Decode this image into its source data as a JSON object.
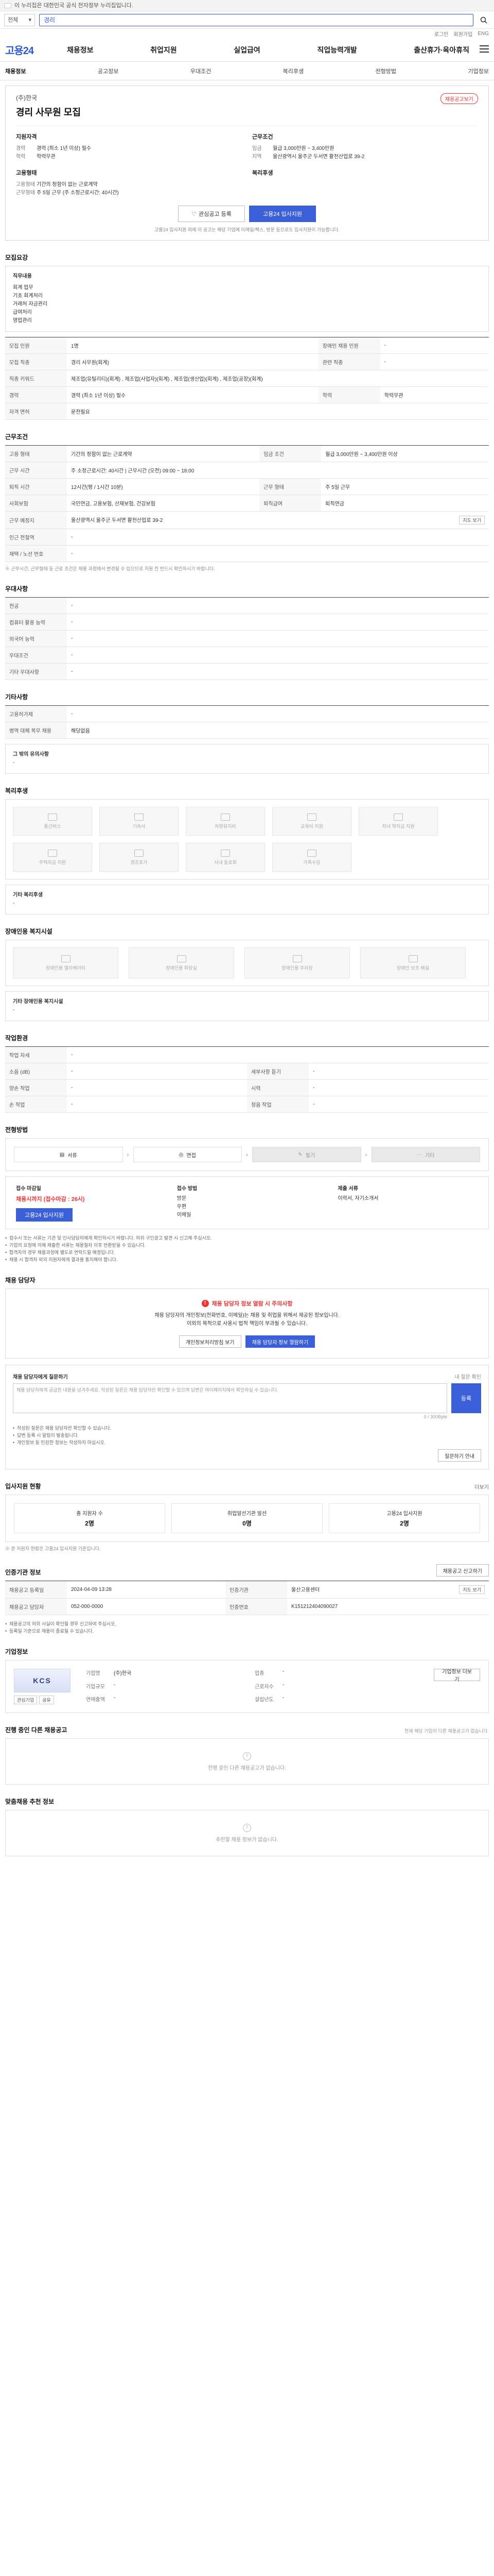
{
  "gov_bar": {
    "text": "이 누리집은 대한민국 공식 전자정부 누리집입니다."
  },
  "search": {
    "scope": "전체",
    "query": "경리"
  },
  "util_links": [
    "로그인",
    "회원가입",
    "ENG"
  ],
  "header": {
    "logo": "고용24",
    "menu": [
      "채용정보",
      "취업지원",
      "실업급여",
      "직업능력개발",
      "출산휴가·육아휴직"
    ]
  },
  "lnb": {
    "items": [
      "채용정보",
      "공고정보",
      "우대조건",
      "복리후생",
      "전형방법",
      "기업정보"
    ],
    "active": 0
  },
  "summary": {
    "company": "(주)한국",
    "title": "경리 사무원 모집",
    "badge": "채용공고보기",
    "cols": [
      {
        "heading": "지원자격",
        "rows": [
          {
            "k": "경력",
            "v": "경력 (최소 1년 이상) 필수"
          },
          {
            "k": "학력",
            "v": "학력무관"
          },
          {
            "k": "",
            "v": ""
          }
        ],
        "heading2": "고용형태",
        "rows2": [
          {
            "k": "고용형태",
            "v": "기간의 정함이 없는 근로계약"
          },
          {
            "k": "근무형태",
            "v": "주 5일 근무 (주 소정근로시간: 40시간)"
          }
        ]
      },
      {
        "heading": "근무조건",
        "rows": [
          {
            "k": "임금",
            "v": "월급 3,000만원 ~ 3,400만원"
          },
          {
            "k": "지역",
            "v": "울산광역시 울주군 두서면 활천산업로 39-2"
          }
        ],
        "heading2": "복리후생",
        "rows2": []
      }
    ],
    "btn_interest": "관심공고 등록",
    "btn_apply": "고용24 입사지원",
    "note": "고용24 입사지원 외에 이 공고는 해당 기업에 이메일/팩스, 방문 등으로도 입사지원이 가능합니다."
  },
  "recruit": {
    "title": "모집요강",
    "duty_label": "직무내용",
    "duty_lines": [
      "회계 업무",
      "기초 회계처리",
      "거래처 자금관리",
      "급여처리",
      "영업관리"
    ],
    "table": [
      {
        "k": "모집 인원",
        "v": "1명",
        "k2": "장애인 채용 인원",
        "v2": "-"
      },
      {
        "k": "모집 직종",
        "v": "경리 사무원(회계)",
        "k2": "관련 직종",
        "v2": "-"
      },
      {
        "k": "직종 키워드",
        "v": "제조업(유틸리티)(회계) , 제조업(사업자)(회계) , 제조업(생산업)(회계) , 제조업(공장)(회계)",
        "k2": "",
        "v2": ""
      },
      {
        "k": "경력",
        "v": "경력 (최소 1년 이상) 필수",
        "k2": "학력",
        "v2": "학력무관"
      },
      {
        "k": "자격 면허",
        "v": "운전필요",
        "k2": "",
        "v2": ""
      }
    ]
  },
  "conditions": {
    "title": "근무조건",
    "rows": [
      {
        "k": "고용 형태",
        "v": "기간의 정함이 없는 근로계약",
        "k2": "임금 조건",
        "v2": "월급 3,000만원 ~ 3,400만원 이상"
      },
      {
        "k": "근무 시간",
        "v": "주 소정근로시간: 40시간 | 근무시간 (오전) 09:00 ~ 18:00",
        "k2": "",
        "v2": ""
      },
      {
        "k": "퇴직 시간",
        "v": "12시간(평 / 1시간 10분)",
        "k2": "근무 형태",
        "v2": "주 5일 근무"
      },
      {
        "k": "사회보험",
        "v": "국민연금, 고용보험, 산재보험, 건강보험",
        "k2": "퇴직급여",
        "v2": "퇴직연금"
      },
      {
        "k": "근무 예정지",
        "v": "울산광역시 울주군 두서면 활천산업로 39-2",
        "k2": "",
        "v2": ""
      },
      {
        "k": "인근 전철역",
        "v": "-",
        "k2": "",
        "v2": ""
      },
      {
        "k": "재택 / 노선 번호",
        "v": "-",
        "k2": "",
        "v2": ""
      }
    ],
    "map_btn": "지도 보기",
    "note": "※ 근무시간, 근무형태 등 근로 조건은 채용 과정에서 변경될 수 있으므로 지원 전 반드시 확인하시기 바랍니다."
  },
  "preference": {
    "title": "우대사항",
    "rows": [
      {
        "k": "전공",
        "v": "-"
      },
      {
        "k": "컴퓨터 활용 능력",
        "v": "-"
      },
      {
        "k": "외국어 능력",
        "v": "-"
      },
      {
        "k": "우대조건",
        "v": "-"
      },
      {
        "k": "기타 우대사항",
        "v": "-"
      }
    ]
  },
  "other": {
    "title": "기타사항",
    "rows": [
      {
        "k": "고용허가제",
        "v": "-"
      },
      {
        "k": "병역 대체 복무 채용",
        "v": "해당없음"
      }
    ],
    "extra_label": "그 밖의 유의사항",
    "extra_value": "-"
  },
  "welfare": {
    "title": "복리후생",
    "items": [
      "통근버스",
      "기숙사",
      "차량유지비",
      "교육비 지원",
      "자녀 학자금 지원",
      "주택자금 지원",
      "경조휴가",
      "사내 동호회",
      "가족수당"
    ],
    "extra_label": "기타 복리후생",
    "extra_value": "-"
  },
  "disability": {
    "title": "장애인용 복지시설",
    "items": [
      "장애인용 엘리베이터",
      "장애인용 화장실",
      "장애인용 주차장",
      "장애인 보조 해설"
    ],
    "extra_label": "기타 장애인용 복지시설",
    "extra_value": "-"
  },
  "workplace": {
    "title": "작업환경",
    "rows": [
      {
        "k": "작업 자세",
        "v": "-",
        "k2": "",
        "v2": ""
      },
      {
        "k": "소음 (dB)",
        "v": "-",
        "k2": "세부사항 듣기",
        "v2": "-"
      },
      {
        "k": "양손 작업",
        "v": "-",
        "k2": "시력",
        "v2": "-"
      },
      {
        "k": "손 작업",
        "v": "-",
        "k2": "청음 작업",
        "v2": "-"
      }
    ]
  },
  "process": {
    "title": "전형방법",
    "steps": [
      {
        "label": "서류",
        "off": false
      },
      {
        "label": "면접",
        "off": false
      },
      {
        "label": "필기",
        "off": true
      },
      {
        "label": "기타",
        "off": true
      }
    ]
  },
  "apply": {
    "col1_title": "접수 마감일",
    "col1_value": "채용시까지 (접수마감 : 26시)",
    "col1_btn": "고용24 입사지원",
    "col2_title": "접수 방법",
    "col2_lines": [
      "방문",
      "우편",
      "이메일"
    ],
    "col3_title": "제출 서류",
    "col3_lines": [
      "이력서, 자기소개서"
    ],
    "notes": [
      "접수시 또는 서류는 기관 및 인사담당자에게 확인하시기 바랍니다. 허위 구인광고 발견 시 신고해 주십시오.",
      "기업의 요청에 의해 제출한 서류는 채용절차 이후 반환받을 수 있습니다.",
      "합격자의 경우 채용과정에 별도로 연락드릴 예정입니다.",
      "채용 시 합격자 외의 지원자에게 결과를 통지해야 합니다."
    ]
  },
  "contact": {
    "title": "채용 담당자",
    "alert": "채용 담당자 정보 열람 시 주의사항",
    "lines": [
      "채용 담당자의 개인정보(전화번호, 이메일)는 채용 및 취업을 위해서 제공된 정보입니다.",
      "이외의 목적으로 사용시 법적 책임이 부과될 수 있습니다."
    ],
    "btn1": "개인정보처리방침 보기",
    "btn2": "채용 담당자 정보 열람하기"
  },
  "inquiry": {
    "title": "채용 담당자에게 질문하기",
    "helper": "내 질문 확인",
    "placeholder": "채용 담당자에게 궁금한 내용을 남겨주세요. 작성된 질문은 채용 담당자만 확인할 수 있으며 답변은 마이페이지에서 확인하실 수 있습니다.",
    "btn": "등록",
    "count": "0 / 300Byte",
    "notes": [
      "작성된 질문은 채용 담당자만 확인할 수 있습니다.",
      "답변 등록 시 알림이 발송됩니다.",
      "개인정보 등 민감한 정보는 작성하지 마십시오."
    ],
    "btn_notice": "질문하기 안내"
  },
  "stats": {
    "title": "입사지원 현황",
    "more": "더보기",
    "items": [
      {
        "label": "총 지원자 수",
        "value": "2명"
      },
      {
        "label": "취업알선기관 알선",
        "value": "0명"
      },
      {
        "label": "고용24 입사지원",
        "value": "2명"
      }
    ],
    "note": "※ 본 지원자 현황은 고용24 입사지원 기준입니다."
  },
  "registration": {
    "title": "인증기관 정보",
    "btn": "채용공고 신고하기",
    "rows": [
      {
        "k": "채용공고 등록일",
        "v": "2024-04-09 13:28",
        "k2": "인증기관",
        "v2": "울산고용센터"
      },
      {
        "k": "채용공고 담당자",
        "v": "052-000-0000",
        "k2": "인증번호",
        "v2": "K151212404090027"
      }
    ],
    "map_btn": "지도 보기",
    "notes": [
      "채용공고의 허위 사실이 확인될 경우 신고하여 주십시오.",
      "등록일 기준으로 채용이 종료될 수 있습니다."
    ]
  },
  "enterprise": {
    "title": "기업정보",
    "logo": "KCS",
    "logo_btns": [
      "관심기업",
      "공유"
    ],
    "info": [
      {
        "k": "기업명",
        "v": "(주)한국"
      },
      {
        "k": "업종",
        "v": "-"
      },
      {
        "k": "기업규모",
        "v": "-"
      },
      {
        "k": "근로자수",
        "v": "-"
      },
      {
        "k": "연매출액",
        "v": "-"
      },
      {
        "k": "설립년도",
        "v": "-"
      }
    ],
    "side_btn": "기업정보 더보기"
  },
  "ongoing": {
    "title": "진행 중인 다른 채용공고",
    "help": "현재 해당 기업의 다른 채용공고가 없습니다.",
    "empty": "진행 중인 다른 채용공고가 없습니다."
  },
  "recommend": {
    "title": "맞춤채용 추천 정보",
    "empty": "추천할 채용 정보가 없습니다."
  }
}
